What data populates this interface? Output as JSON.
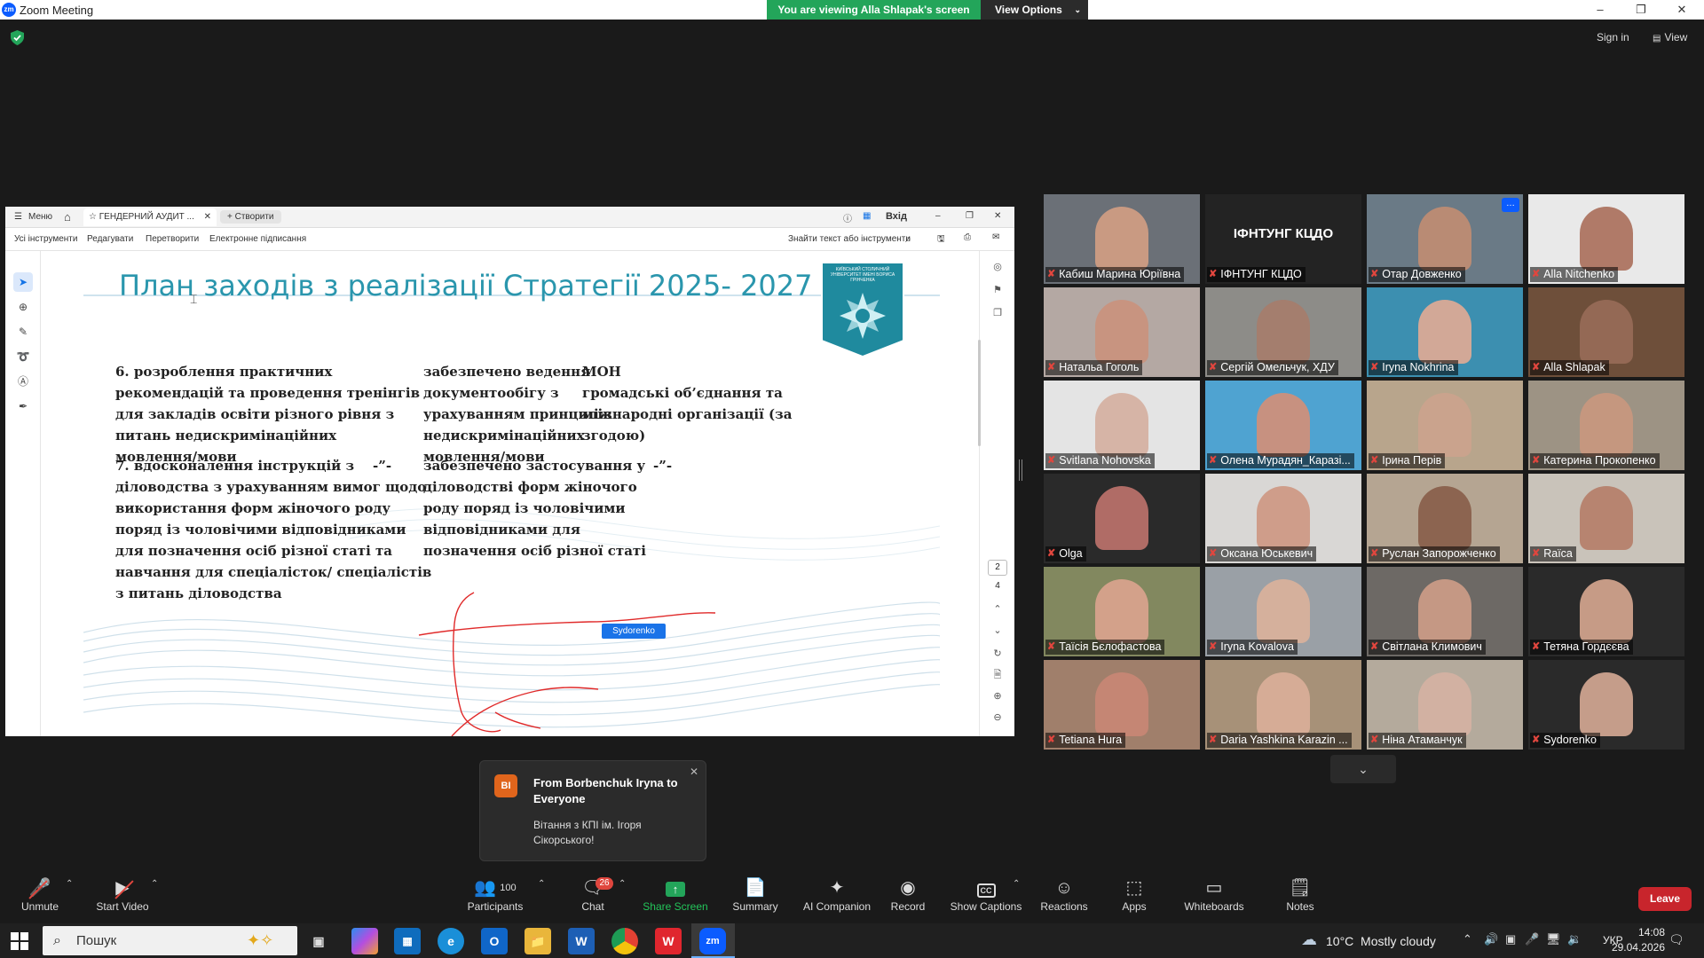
{
  "window": {
    "title": "Zoom Meeting",
    "banner": "You are viewing Alla Shlapak's screen",
    "view_options": "View Options",
    "sign_in": "Sign in",
    "view": "View"
  },
  "acrobat": {
    "menu_label": "Меню",
    "doc_tab": "ГЕНДЕРНИЙ АУДИТ ...",
    "create_label": "Створити",
    "login": "Вхід",
    "menu_items": [
      "Усі інструменти",
      "Редагувати",
      "Перетворити",
      "Електронне підписання"
    ],
    "find_placeholder": "Знайти текст або інструменти",
    "page_current": "2",
    "page_total": "4"
  },
  "slide": {
    "title": "План заходів з реалізації Стратегії 2025- 2027",
    "logo_text": "КИЇВСЬКИЙ СТОЛИЧНИЙ УНІВЕРСИТЕТ ІМЕНІ БОРИСА ГРІНЧЕНКА",
    "item6": "6. розроблення практичних\nрекомендацій та проведення тренінгів\nдля закладів освіти різного рівня з\nпитань недискримінаційних\nмовлення/мови",
    "result6": "забезпечено ведення\nдокументообігу з\nурахуванням принципів\nнедискримінаційних\nмовлення/мови",
    "resp6": "МОН\n громадські об’єднання та\nміжнародні організації (за\nзгодою)",
    "item7": "7. вдосконалення інструкцій з\nділоводства з урахуванням вимог щодо\nвикористання форм жіночого роду\nпоряд із чоловічими відповідниками\nдля позначення осіб різної статі та\nнавчання для спеціалісток/ спеціалістів\nз питань діловодства",
    "ditto1": "-”-",
    "result7": "забезпечено застосування у\nділоводстві форм жіночого\nроду поряд із чоловічими\nвідповідниками для\nпозначення осіб різної статі",
    "ditto2": "-”-",
    "annotator": "Sydorenko"
  },
  "participants": [
    {
      "name": "Кабиш Марина Юріївна",
      "bg": "#6b7077",
      "face": "#c99a82"
    },
    {
      "name": "ІФНТУНГ КЦДО",
      "label": "ІФНТУНГ КЦДО",
      "bg": "#232323",
      "face": ""
    },
    {
      "name": "Отар Довженко",
      "bg": "#6a7a86",
      "face": "#b98b74"
    },
    {
      "name": "Alla Nitchenko",
      "bg": "#e9e9e9",
      "face": "#b07a68"
    },
    {
      "name": "Натальа Гоголь",
      "bg": "#b4a8a3",
      "face": "#c89480"
    },
    {
      "name": "Сергій Омельчук, ХДУ",
      "bg": "#8d8c88",
      "face": "#a47e6e"
    },
    {
      "name": "Iryna Nokhrina",
      "bg": "#3c8fb0",
      "face": "#d2a897"
    },
    {
      "name": "Alla Shlapak",
      "bg": "#6e4f3a",
      "face": "#946955"
    },
    {
      "name": "Svitlana Nohovska",
      "bg": "#e4e4e4",
      "face": "#d6b4a6"
    },
    {
      "name": "Олена Мурадян_Каразі...",
      "bg": "#4fa3d1",
      "face": "#c79180"
    },
    {
      "name": "Ірина Перів",
      "bg": "#b8a58c",
      "face": "#caa38d"
    },
    {
      "name": "Катерина Прокопенко",
      "bg": "#9d9384",
      "face": "#c5977f"
    },
    {
      "name": "Olga",
      "bg": "#2a2a2a",
      "face": "#b06c66"
    },
    {
      "name": "Оксана Юськевич",
      "bg": "#d9d7d5",
      "face": "#cf9d8a"
    },
    {
      "name": "Руслан Запорожченко",
      "bg": "#b5a592",
      "face": "#8c6450"
    },
    {
      "name": "Raїca",
      "bg": "#c9c3ba",
      "face": "#b78470"
    },
    {
      "name": "Таїсія Бєлофастова",
      "bg": "#82885f",
      "face": "#d3a18a"
    },
    {
      "name": "Iryna Kovalova",
      "bg": "#9aa0a6",
      "face": "#d5b09c"
    },
    {
      "name": "Світлана Климович",
      "bg": "#6d6965",
      "face": "#c59884"
    },
    {
      "name": "Тетяна Гордєєва",
      "bg": "#2a2a2a",
      "face": "#c69b86"
    },
    {
      "name": "Tetiana Hura",
      "bg": "#a07f6b",
      "face": "#c58674"
    },
    {
      "name": "Daria Yashkina Karazin ...",
      "bg": "#a79178",
      "face": "#d6ac96"
    },
    {
      "name": "Ніна Атаманчук",
      "bg": "#b4aa9c",
      "face": "#d2b1a2"
    },
    {
      "name": "Sydorenko",
      "bg": "#2a2a2a",
      "face": "#c59d8a"
    }
  ],
  "chat_toast": {
    "initials": "BI",
    "from": "From Borbenchuk Iryna to Everyone",
    "message": "Вітання з КПІ ім. Ігоря Сікорського!"
  },
  "toolbar": {
    "unmute": "Unmute",
    "start_video": "Start Video",
    "participants": "Participants",
    "participant_count": "100",
    "chat": "Chat",
    "chat_badge": "26",
    "share_screen": "Share Screen",
    "summary": "Summary",
    "ai_companion": "AI Companion",
    "record": "Record",
    "show_captions": "Show Captions",
    "reactions": "Reactions",
    "apps": "Apps",
    "whiteboards": "Whiteboards",
    "notes": "Notes",
    "leave": "Leave"
  },
  "taskbar": {
    "search_placeholder": "Пошук",
    "weather": "10°C  Mostly cloudy",
    "lang": "УКР",
    "time": "14:08",
    "date": "29.04.2026"
  }
}
